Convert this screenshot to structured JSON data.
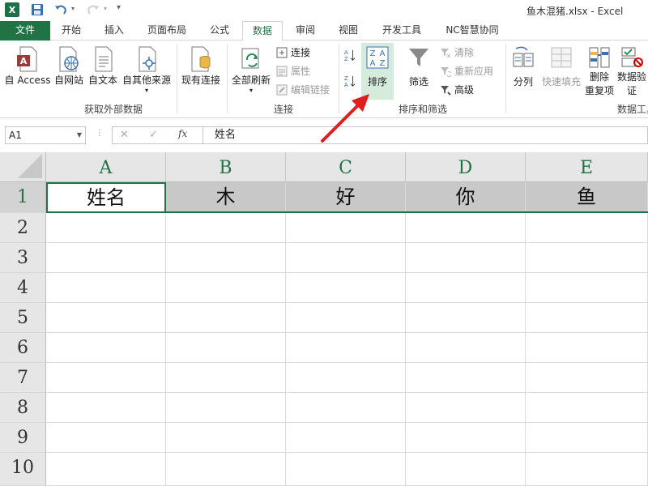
{
  "window": {
    "title": "鱼木混猪.xlsx - Excel",
    "app_icon_letter": "X"
  },
  "tabs": [
    {
      "label": "文件"
    },
    {
      "label": "开始"
    },
    {
      "label": "插入"
    },
    {
      "label": "页面布局"
    },
    {
      "label": "公式"
    },
    {
      "label": "数据"
    },
    {
      "label": "审阅"
    },
    {
      "label": "视图"
    },
    {
      "label": "开发工具"
    },
    {
      "label": "NC智慧协同"
    }
  ],
  "active_tab": "数据",
  "ribbon": {
    "external_data": {
      "group_label": "获取外部数据",
      "from_access": "自 Access",
      "from_web": "自网站",
      "from_text": "自文本",
      "from_other": "自其他来源",
      "existing_connections": "现有连接"
    },
    "connections": {
      "group_label": "连接",
      "refresh_all": "全部刷新",
      "connections": "连接",
      "properties": "属性",
      "edit_links": "编辑链接"
    },
    "sort_filter": {
      "group_label": "排序和筛选",
      "sort_az": "A→Z",
      "sort_za": "Z→A",
      "sort": "排序",
      "filter": "筛选",
      "clear": "清除",
      "reapply": "重新应用",
      "advanced": "高级"
    },
    "data_tools": {
      "group_label": "数据工具",
      "text_to_columns": "分列",
      "flash_fill": "快速填充",
      "remove_duplicates_l1": "删除",
      "remove_duplicates_l2": "重复项",
      "data_validation_l1": "数据验",
      "data_validation_l2": "证"
    }
  },
  "formula_bar": {
    "name_box": "A1",
    "formula": "姓名",
    "fx": "fx"
  },
  "grid": {
    "columns": [
      "A",
      "B",
      "C",
      "D",
      "E"
    ],
    "rows": [
      "1",
      "2",
      "3",
      "4",
      "5",
      "6",
      "7",
      "8",
      "9",
      "10"
    ],
    "row1": [
      "姓名",
      "木",
      "好",
      "你",
      "鱼"
    ]
  },
  "colors": {
    "accent": "#217346",
    "arrow": "#e02020"
  }
}
